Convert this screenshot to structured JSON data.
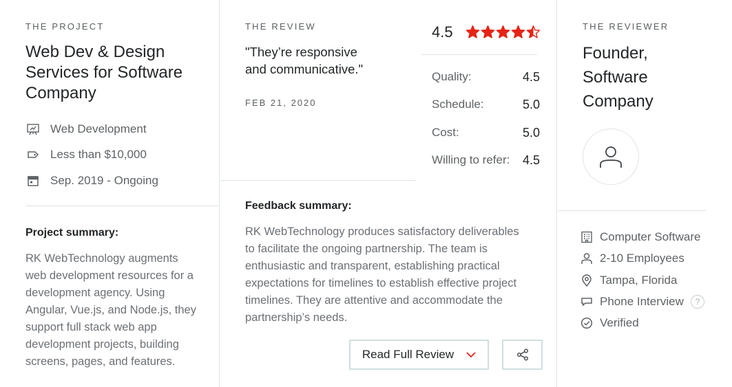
{
  "project": {
    "eyebrow": "THE PROJECT",
    "title": "Web Dev & Design Services for Software Company",
    "service": "Web Development",
    "budget": "Less than $10,000",
    "duration": "Sep. 2019 - Ongoing",
    "summary_heading": "Project summary:",
    "summary_lines": [
      "RK WebTechnology augments",
      "web development resources for a",
      "development agency. Using",
      "Angular, Vue.js, and Node.js, they",
      "support full stack web app",
      "development projects, building",
      "screens, pages, and features."
    ]
  },
  "review": {
    "eyebrow": "THE REVIEW",
    "quote_lines": [
      "\"They’re responsive",
      "and communicative.\""
    ],
    "date": "FEB 21, 2020",
    "overall": "4.5",
    "rating_value": 4.5,
    "rating_max": 5,
    "scores": [
      {
        "label": "Quality:",
        "value": "4.5"
      },
      {
        "label": "Schedule:",
        "value": "5.0"
      },
      {
        "label": "Cost:",
        "value": "5.0"
      },
      {
        "label": "Willing to refer:",
        "value": "4.5"
      }
    ],
    "feedback_heading": "Feedback summary:",
    "feedback_lines": [
      "RK WebTechnology produces satisfactory deliverables",
      "to facilitate the ongoing partnership. The team is",
      "enthusiastic and transparent, establishing practical",
      "expectations for timelines to establish effective project",
      "timelines. They are attentive and accommodate the",
      "partnership’s needs."
    ],
    "read_full_label": "Read Full Review"
  },
  "reviewer": {
    "eyebrow": "THE REVIEWER",
    "title_lines": [
      "Founder,",
      "Software",
      "Company"
    ],
    "industry": "Computer Software",
    "size": "2-10 Employees",
    "location": "Tampa, Florida",
    "interview": "Phone Interview",
    "help_glyph": "?",
    "verified": "Verified"
  },
  "colors": {
    "star": "#e62415",
    "accent_chevron": "#e62415",
    "border": "#dfe5e6",
    "button_border": "#cfdfe0"
  },
  "icons": [
    "presentation-icon",
    "tag-icon",
    "calendar-icon",
    "star-icon",
    "chevron-down-icon",
    "share-icon",
    "user-icon",
    "building-icon",
    "people-icon",
    "location-pin-icon",
    "chat-icon",
    "help-icon",
    "check-circle-icon"
  ]
}
